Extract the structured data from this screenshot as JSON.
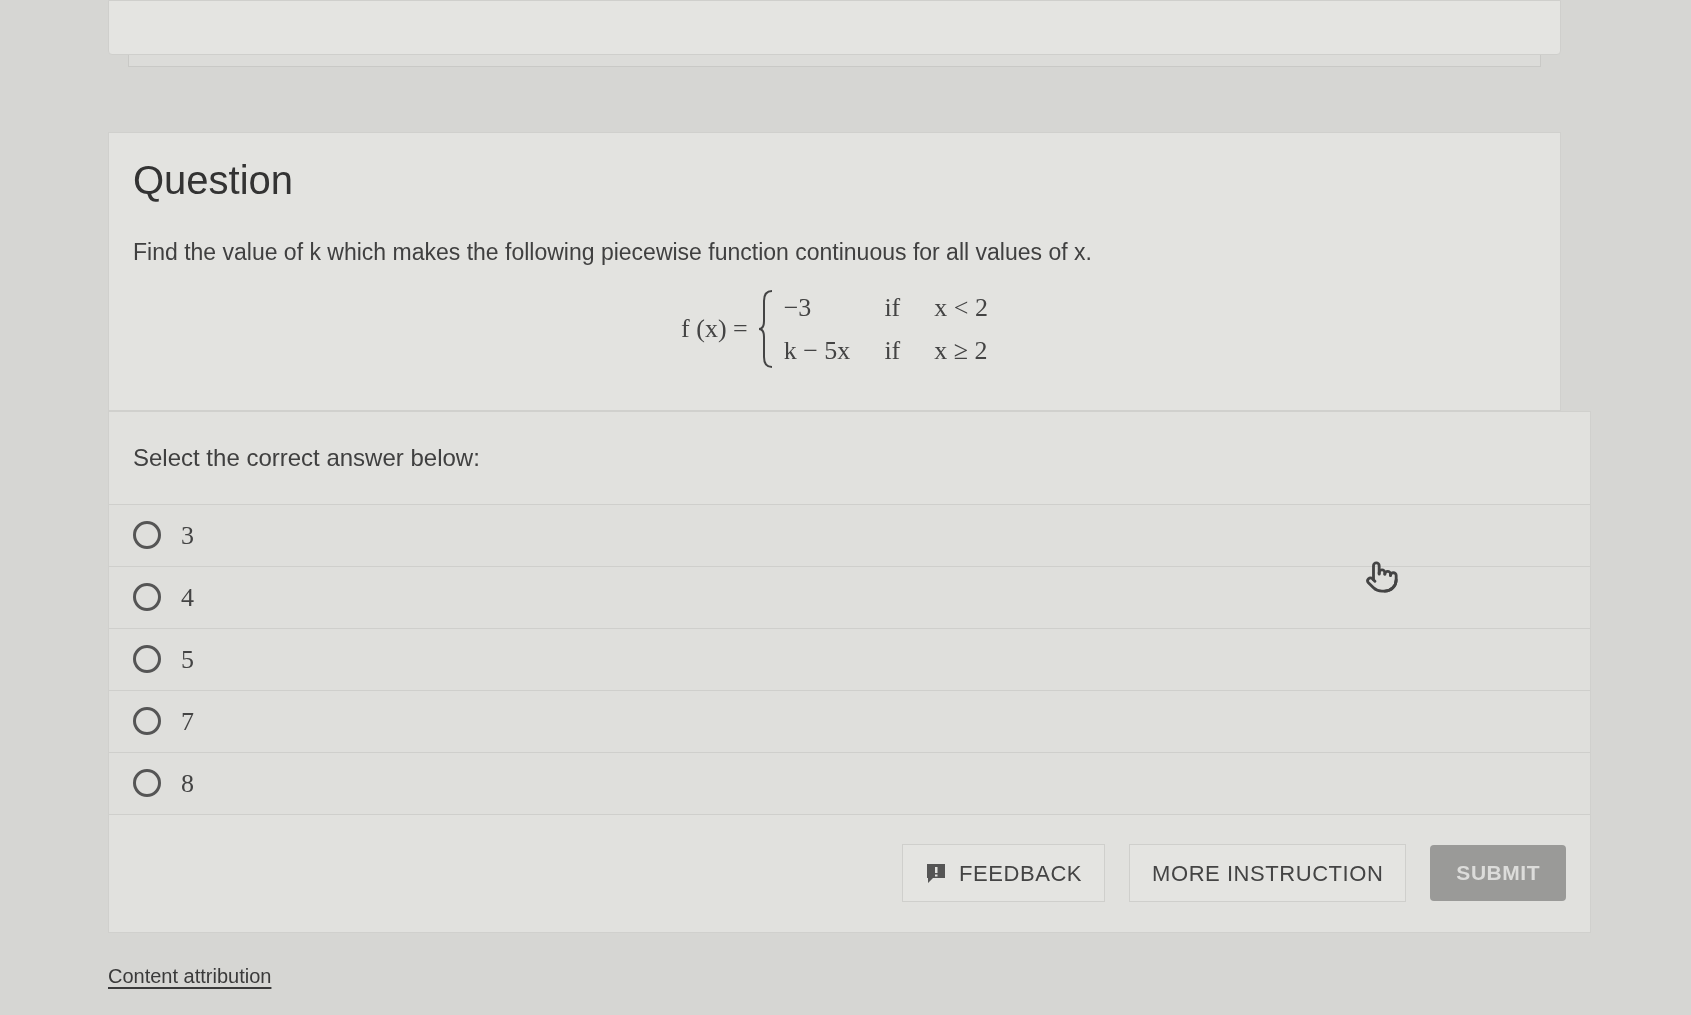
{
  "question": {
    "heading": "Question",
    "prompt": "Find the value of k which makes the following piecewise function continuous for all values of x.",
    "formula": {
      "lhs": "f (x) =",
      "cases": [
        {
          "expr": "−3",
          "word": "if",
          "condition": "x < 2"
        },
        {
          "expr": "k − 5x",
          "word": "if",
          "condition": "x ≥ 2"
        }
      ]
    }
  },
  "answer_prompt": "Select the correct answer below:",
  "options": [
    {
      "label": "3",
      "selected": false
    },
    {
      "label": "4",
      "selected": false
    },
    {
      "label": "5",
      "selected": false
    },
    {
      "label": "7",
      "selected": false
    },
    {
      "label": "8",
      "selected": false
    }
  ],
  "buttons": {
    "feedback": "FEEDBACK",
    "more_instruction": "MORE INSTRUCTION",
    "submit": {
      "label": "SUBMIT",
      "disabled": true
    }
  },
  "footer_link": "Content attribution"
}
